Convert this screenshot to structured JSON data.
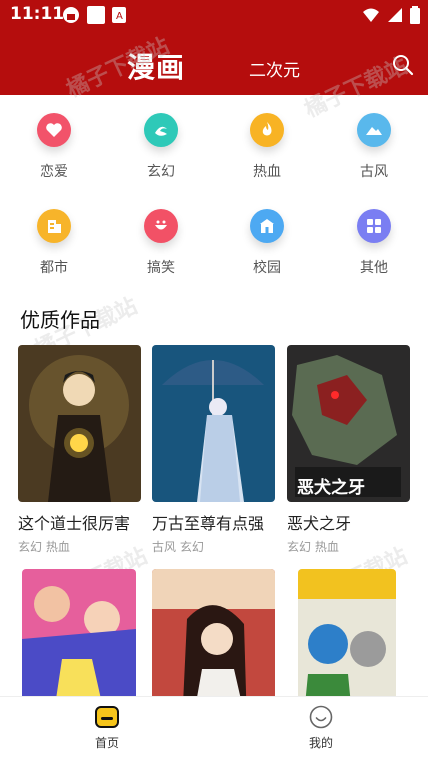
{
  "status": {
    "time": "11:11"
  },
  "header": {
    "title": "漫画",
    "subtitle": "二次元"
  },
  "categories": [
    {
      "label": "恋爱",
      "icon": "heart-icon",
      "color": "#f2536a"
    },
    {
      "label": "玄幻",
      "icon": "swirl-icon",
      "color": "#2ec9b8"
    },
    {
      "label": "热血",
      "icon": "flame-icon",
      "color": "#f8b324"
    },
    {
      "label": "古风",
      "icon": "mountain-icon",
      "color": "#59b8ec"
    },
    {
      "label": "都市",
      "icon": "building-icon",
      "color": "#f7b42a"
    },
    {
      "label": "搞笑",
      "icon": "laugh-icon",
      "color": "#f25166"
    },
    {
      "label": "校园",
      "icon": "school-icon",
      "color": "#4da9f2"
    },
    {
      "label": "其他",
      "icon": "grid-icon",
      "color": "#7a7ef2"
    }
  ],
  "section": {
    "title": "优质作品"
  },
  "works": [
    {
      "title": "这个道士很厉害",
      "tags": "玄幻 热血"
    },
    {
      "title": "万古至尊有点强",
      "tags": "古风 玄幻"
    },
    {
      "title": "恶犬之牙",
      "tags": "玄幻 热血",
      "cover_text": "恶犬之牙"
    },
    {
      "title": "",
      "tags": ""
    },
    {
      "title": "",
      "tags": ""
    },
    {
      "title": "",
      "tags": ""
    }
  ],
  "tabs": [
    {
      "label": "首页",
      "icon": "home-icon"
    },
    {
      "label": "我的",
      "icon": "smile-icon"
    }
  ],
  "watermark": "橘子下载站"
}
